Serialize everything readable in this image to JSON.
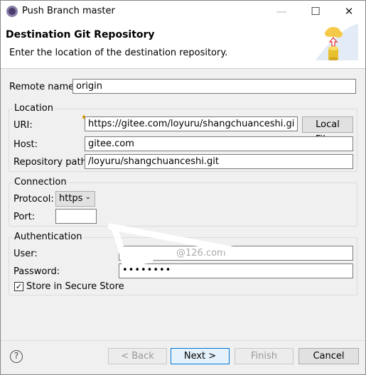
{
  "window": {
    "title": "Push Branch master",
    "minimize_icon": "minimize-icon",
    "maximize_icon": "maximize-icon",
    "close_icon": "close-icon"
  },
  "header": {
    "title": "Destination Git Repository",
    "description": "Enter the location of the destination repository.",
    "icon": "push-to-cloud-icon"
  },
  "remote": {
    "label": "Remote name:",
    "value": "origin"
  },
  "location": {
    "title": "Location",
    "uri_label": "URI:",
    "uri_value": "https://gitee.com/loyuru/shangchuanceshi.git",
    "local_file_button": "Local File...",
    "host_label": "Host:",
    "host_value": "gitee.com",
    "path_label": "Repository path:",
    "path_value": "/loyuru/shangchuanceshi.git"
  },
  "connection": {
    "title": "Connection",
    "protocol_label": "Protocol:",
    "protocol_value": "https",
    "port_label": "Port:",
    "port_value": ""
  },
  "authentication": {
    "title": "Authentication",
    "user_label": "User:",
    "user_value": "@126.com",
    "password_label": "Password:",
    "password_value": "••••••••",
    "store_label": "Store in Secure Store",
    "store_checked": true
  },
  "footer": {
    "help_icon": "help-icon",
    "back": "< Back",
    "next": "Next >",
    "finish": "Finish",
    "cancel": "Cancel"
  }
}
